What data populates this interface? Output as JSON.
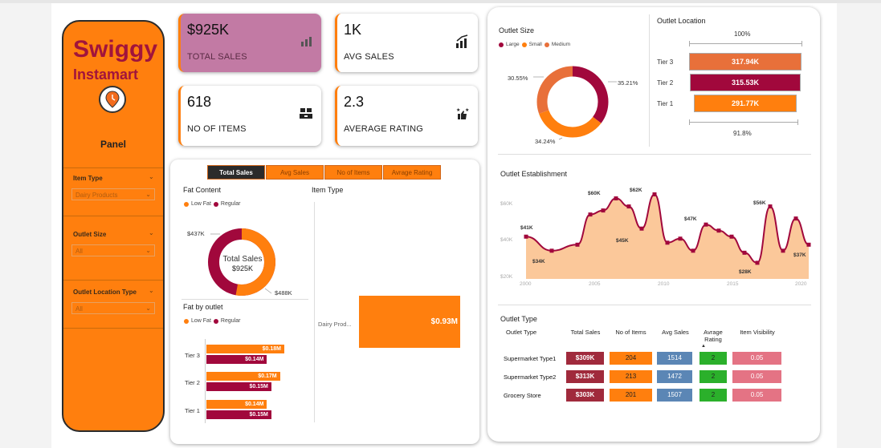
{
  "brand": {
    "name": "Swiggy",
    "sub": "Instamart",
    "panel_title": "Panel"
  },
  "slicers": [
    {
      "label": "Item Type",
      "value": "Dairy Products"
    },
    {
      "label": "Outlet Size",
      "value": "All"
    },
    {
      "label": "Outlet Location Type",
      "value": "All"
    }
  ],
  "kpis": [
    {
      "value": "$925K",
      "caption": "TOTAL SALES",
      "icon": "bar-chart-icon"
    },
    {
      "value": "1K",
      "caption": "AVG SALES",
      "icon": "growth-chart-icon"
    },
    {
      "value": "618",
      "caption": "NO OF ITEMS",
      "icon": "boxes-icon"
    },
    {
      "value": "2.3",
      "caption": "AVERAGE RATING",
      "icon": "rating-icon"
    }
  ],
  "tabs": [
    "Total Sales",
    "Avg Sales",
    "No of Items",
    "Avrage Rating"
  ],
  "fat_content": {
    "title": "Fat Content",
    "legend": [
      "Low Fat",
      "Regular"
    ],
    "center_title": "Total Sales",
    "center_value": "$925K",
    "labels": [
      "$437K",
      "$488K"
    ]
  },
  "item_type": {
    "title": "Item Type",
    "category": "Dairy Prod...",
    "value_label": "$0.93M"
  },
  "fat_by_outlet": {
    "title": "Fat by outlet",
    "legend": [
      "Low Fat",
      "Regular"
    ],
    "rows": [
      {
        "tier": "Tier 3",
        "low": "$0.18M",
        "reg": "$0.14M"
      },
      {
        "tier": "Tier 2",
        "low": "$0.17M",
        "reg": "$0.15M"
      },
      {
        "tier": "Tier 1",
        "low": "$0.14M",
        "reg": "$0.15M"
      }
    ]
  },
  "outlet_size": {
    "title": "Outlet Size",
    "legend": [
      "Large",
      "Small",
      "Medium"
    ],
    "labels": [
      "30.55%",
      "35.21%",
      "34.24%"
    ]
  },
  "outlet_location": {
    "title": "Outlet Location",
    "top_pct": "100%",
    "bottom_pct": "91.8%",
    "rows": [
      {
        "tier": "Tier 3",
        "value": "317.94K"
      },
      {
        "tier": "Tier 2",
        "value": "315.53K"
      },
      {
        "tier": "Tier 1",
        "value": "291.77K"
      }
    ]
  },
  "establishment": {
    "title": "Outlet Establishment",
    "y_ticks": [
      "$60K",
      "$40K",
      "$20K"
    ],
    "x_ticks": [
      "2000",
      "2005",
      "2010",
      "2015",
      "2020"
    ],
    "labels": [
      "$41K",
      "$34K",
      "$60K",
      "$45K",
      "$62K",
      "$47K",
      "$28K",
      "$56K",
      "$37K"
    ]
  },
  "outlet_type": {
    "title": "Outlet Type",
    "headers": [
      "Outlet Type",
      "Total Sales",
      "No of Items",
      "Avg Sales",
      "Avrage Rating",
      "Item Visibility"
    ],
    "rows": [
      {
        "type": "Supermarket Type1",
        "sales": "$309K",
        "items": "204",
        "avg": "1514",
        "rating": "2",
        "vis": "0.05"
      },
      {
        "type": "Supermarket Type2",
        "sales": "$313K",
        "items": "213",
        "avg": "1472",
        "rating": "2",
        "vis": "0.05"
      },
      {
        "type": "Grocery Store",
        "sales": "$303K",
        "items": "201",
        "avg": "1507",
        "rating": "2",
        "vis": "0.05"
      }
    ]
  },
  "chart_data": [
    {
      "type": "pie",
      "title": "Fat Content",
      "categories": [
        "Low Fat",
        "Regular"
      ],
      "values": [
        488,
        437
      ]
    },
    {
      "type": "bar",
      "title": "Item Type",
      "categories": [
        "Dairy Products"
      ],
      "values": [
        0.93
      ]
    },
    {
      "type": "bar",
      "title": "Fat by outlet",
      "categories": [
        "Tier 3",
        "Tier 2",
        "Tier 1"
      ],
      "series": [
        {
          "name": "Low Fat",
          "values": [
            0.18,
            0.17,
            0.14
          ]
        },
        {
          "name": "Regular",
          "values": [
            0.14,
            0.15,
            0.15
          ]
        }
      ]
    },
    {
      "type": "pie",
      "title": "Outlet Size",
      "categories": [
        "Large",
        "Small",
        "Medium"
      ],
      "values": [
        35.21,
        34.24,
        30.55
      ]
    },
    {
      "type": "bar",
      "title": "Outlet Location",
      "categories": [
        "Tier 3",
        "Tier 2",
        "Tier 1"
      ],
      "values": [
        317.94,
        315.53,
        291.77
      ]
    },
    {
      "type": "area",
      "title": "Outlet Establishment",
      "x": [
        1998,
        2000,
        2002,
        2003,
        2004,
        2005,
        2006,
        2007,
        2008,
        2009,
        2010,
        2011,
        2012,
        2013,
        2014,
        2015,
        2016,
        2017,
        2018,
        2019,
        2020
      ],
      "y": [
        41,
        34,
        37,
        52,
        54,
        60,
        56,
        45,
        62,
        38,
        40,
        34,
        47,
        44,
        41,
        33,
        28,
        56,
        34,
        50,
        37
      ],
      "ylim": [
        20,
        65
      ]
    }
  ]
}
